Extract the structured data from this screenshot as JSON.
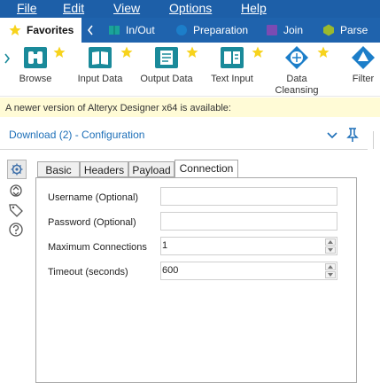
{
  "menu": {
    "file": "File",
    "edit": "Edit",
    "view": "View",
    "options": "Options",
    "help": "Help"
  },
  "tabs": {
    "favorites": "Favorites",
    "inout": "In/Out",
    "preparation": "Preparation",
    "join": "Join",
    "parse": "Parse"
  },
  "tools": {
    "browse": "Browse",
    "input_data": "Input Data",
    "output_data": "Output Data",
    "text_input": "Text Input",
    "data_cleansing_1": "Data",
    "data_cleansing_2": "Cleansing",
    "filter": "Filter"
  },
  "notice": "A newer version of Alteryx Designer x64 is available:",
  "config": {
    "title": "Download (2) - Configuration",
    "tabs": [
      "Basic",
      "Headers",
      "Payload",
      "Connection"
    ],
    "active_tab": "Connection",
    "fields": {
      "username_label": "Username (Optional)",
      "username_value": "",
      "password_label": "Password (Optional)",
      "password_value": "",
      "max_connections_label": "Maximum Connections",
      "max_connections_value": "1",
      "timeout_label": "Timeout (seconds)",
      "timeout_value": "600"
    }
  },
  "colors": {
    "menubar": "#1d5fa8",
    "tabbar": "#1f63ad",
    "accent": "#1d6fb8",
    "star": "#f7d31c",
    "tool_teal": "#1a8a9a",
    "notice_bg": "#fffbd6"
  },
  "icons": {
    "favorites_tab": "star-icon",
    "inout_tab": "book-icon",
    "preparation_tab": "circle-icon",
    "join_tab": "square-icon",
    "parse_tab": "hexagon-icon",
    "collapse": "chevron-down-icon",
    "pin": "pin-icon",
    "settings": "gear-icon",
    "metadata": "arrows-icon",
    "annotation": "tag-icon",
    "help": "help-icon"
  }
}
